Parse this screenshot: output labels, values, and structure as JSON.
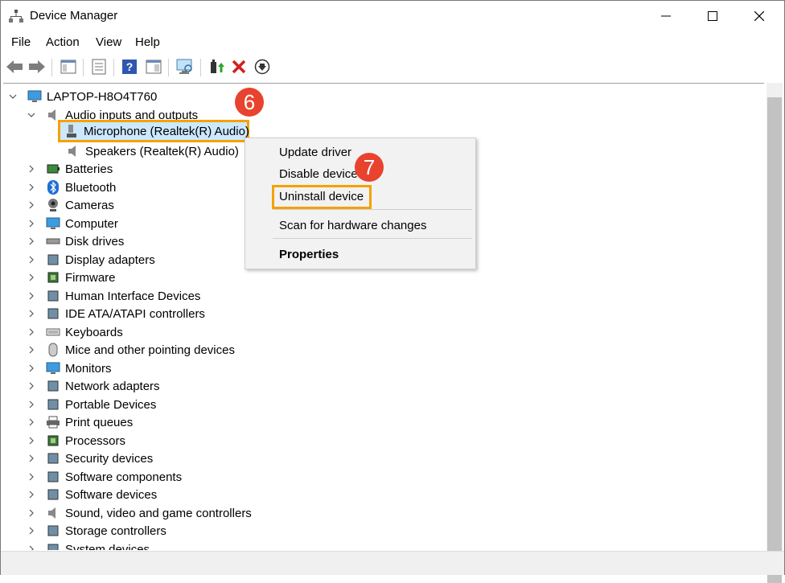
{
  "window": {
    "title": "Device Manager",
    "controls": [
      "minimize",
      "maximize",
      "close"
    ]
  },
  "menu": [
    "File",
    "Action",
    "View",
    "Help"
  ],
  "toolbar": {
    "icons": [
      "back-arrow-icon",
      "forward-arrow-icon",
      "show-hide-tree-icon",
      "properties-icon",
      "help-icon",
      "view-icon",
      "scan-monitor-icon",
      "update-driver-icon",
      "uninstall-x-icon",
      "download-icon"
    ]
  },
  "tree": {
    "root": "LAPTOP-H8O4T760",
    "audio_category": "Audio inputs and outputs",
    "audio_children": [
      "Microphone (Realtek(R) Audio)",
      "Speakers (Realtek(R) Audio)"
    ],
    "categories": [
      "Batteries",
      "Bluetooth",
      "Cameras",
      "Computer",
      "Disk drives",
      "Display adapters",
      "Firmware",
      "Human Interface Devices",
      "IDE ATA/ATAPI controllers",
      "Keyboards",
      "Mice and other pointing devices",
      "Monitors",
      "Network adapters",
      "Portable Devices",
      "Print queues",
      "Processors",
      "Security devices",
      "Software components",
      "Software devices",
      "Sound, video and game controllers",
      "Storage controllers",
      "System devices"
    ]
  },
  "context_menu": {
    "items": [
      "Update driver",
      "Disable device",
      "Uninstall device",
      "Scan for hardware changes",
      "Properties"
    ]
  },
  "badges": {
    "step6": "6",
    "step7": "7"
  },
  "colors": {
    "highlight_border": "#f5a100",
    "badge": "#e8432e",
    "selection": "#cce8ff"
  }
}
